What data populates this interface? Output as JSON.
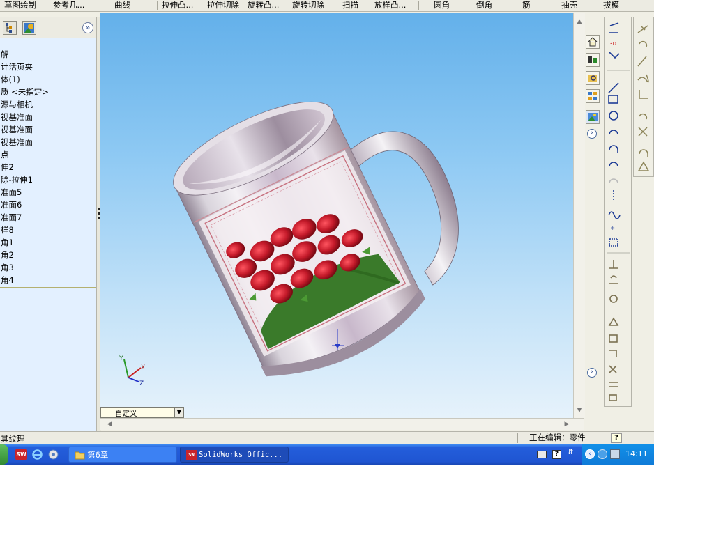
{
  "toolbar": {
    "items": [
      "草图绘制",
      "参考几...",
      "曲线",
      "拉伸凸...",
      "拉伸切除",
      "旋转凸...",
      "旋转切除",
      "扫描",
      "放样凸...",
      "圆角",
      "倒角",
      "筋",
      "抽壳",
      "拔模"
    ]
  },
  "feature_tree": {
    "items": [
      "解",
      "计活页夹",
      "体(1)",
      "质 <未指定>",
      "源与相机",
      "视基准面",
      "视基准面",
      "视基准面",
      "点",
      "伸2",
      "除-拉伸1",
      "准面5",
      "准面6",
      "准面7",
      "样8",
      "角1",
      "角2",
      "角3",
      "角4"
    ]
  },
  "view": {
    "orientation_label": "自定义",
    "axis_x": "X",
    "axis_y": "Y",
    "axis_z": "Z"
  },
  "status_bar": {
    "left_text": "其纹理",
    "edit_status": "正在编辑：零件",
    "help": "?"
  },
  "taskbar": {
    "folder_task": "第6章",
    "app_task": "SolidWorks Offic...",
    "clock": "14:11"
  },
  "colors": {
    "viewport_top": "#63b0ea",
    "viewport_bottom": "#e6f2fb",
    "tree_bg": "#e3f0ff",
    "taskbar_blue": "#245edb",
    "mug_body": "#c4b2c6",
    "rose_red": "#c41a2a"
  },
  "icons": [
    "sw-app-icon",
    "ie-icon",
    "media-icon",
    "folder-icon",
    "keyboard-icon",
    "help-tray-icon",
    "network-icon",
    "volume-icon"
  ]
}
